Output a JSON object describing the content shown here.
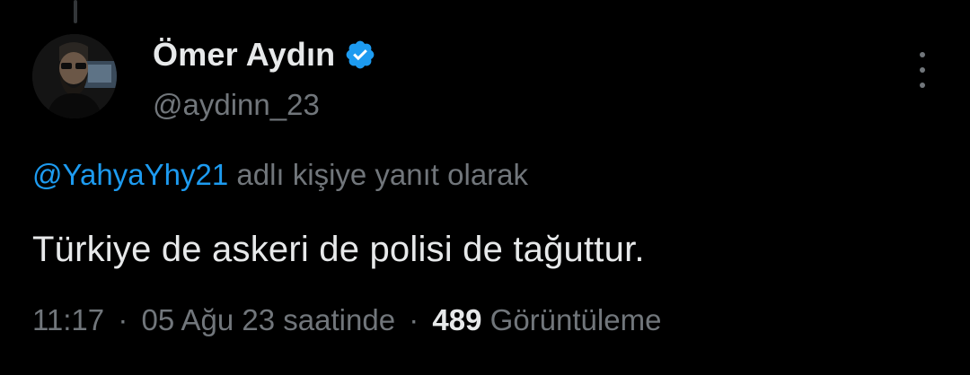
{
  "tweet": {
    "author": {
      "display_name": "Ömer Aydın",
      "handle": "@aydinn_23",
      "verified": true
    },
    "reply_to": {
      "handle": "@YahyaYhy21",
      "suffix": "adlı kişiye yanıt olarak"
    },
    "text": "Türkiye de askeri de polisi de tağuttur.",
    "meta": {
      "time": "11:17",
      "separator": "·",
      "date": "05 Ağu 23 saatinde",
      "views_count": "489",
      "views_label": "Görüntüleme"
    }
  },
  "icons": {
    "verified": "verified-badge-icon",
    "more": "more-vertical-icon"
  },
  "colors": {
    "background": "#000000",
    "primary_text": "#e7e9ea",
    "secondary_text": "#71767b",
    "accent": "#1d9bf0"
  }
}
